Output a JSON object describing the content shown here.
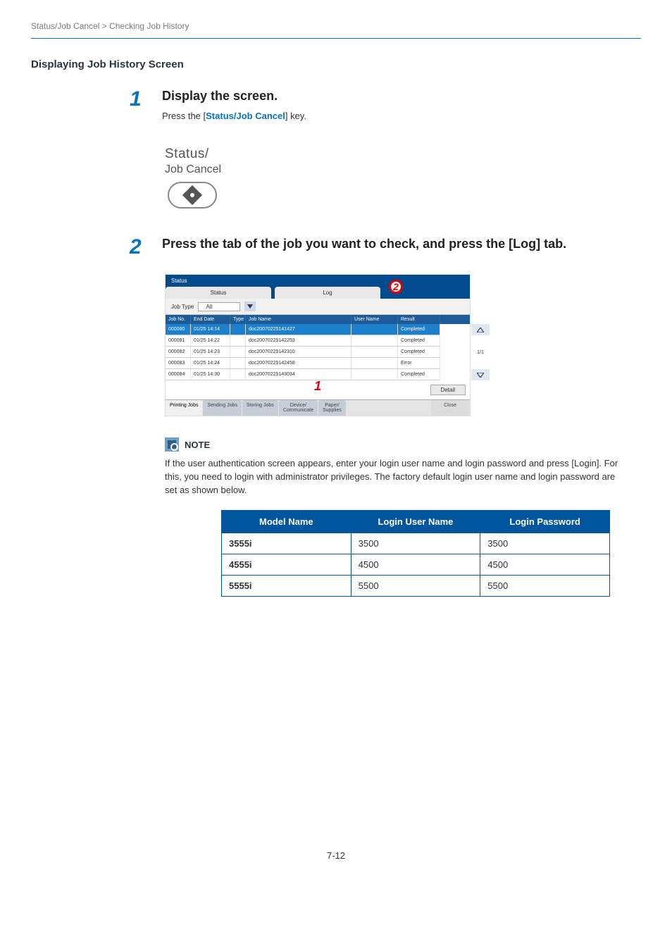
{
  "breadcrumb": "Status/Job Cancel > Checking Job History",
  "section_title": "Displaying Job History Screen",
  "step1": {
    "num": "1",
    "heading": "Display the screen.",
    "prefix": "Press the [",
    "key": "Status/Job Cancel",
    "suffix": "] key.",
    "key_line1": "Status/",
    "key_line2": "Job Cancel"
  },
  "step2": {
    "num": "2",
    "heading": "Press the tab of the job you want to check, and press the [Log] tab."
  },
  "device": {
    "title": "Status",
    "mode_status": "Status",
    "mode_log": "Log",
    "jobtype_label": "Job Type",
    "jobtype_value": "All",
    "cols": {
      "no": "Job No.",
      "end": "End Date",
      "type": "Type",
      "name": "Job Name",
      "user": "User Name",
      "result": "Result"
    },
    "rows": [
      {
        "no": "000080",
        "end": "01/25 14:14",
        "type": "",
        "name": "doc20070225141427",
        "user": "",
        "result": "Completed"
      },
      {
        "no": "000081",
        "end": "01/25 14:22",
        "type": "",
        "name": "doc20070225142253",
        "user": "",
        "result": "Completed"
      },
      {
        "no": "000082",
        "end": "01/25 14:23",
        "type": "",
        "name": "doc20070225142310",
        "user": "",
        "result": "Completed"
      },
      {
        "no": "000083",
        "end": "01/25 14:24",
        "type": "",
        "name": "doc20070225142458",
        "user": "",
        "result": "Error"
      },
      {
        "no": "000084",
        "end": "01/25 14:30",
        "type": "",
        "name": "doc20070225143034",
        "user": "",
        "result": "Completed"
      }
    ],
    "page_indicator": "1/1",
    "detail": "Detail",
    "bottom": {
      "printing": "Printing Jobs",
      "sending": "Sending Jobs",
      "storing": "Storing Jobs",
      "device": "Device/\nCommunicate",
      "paper": "Paper/\nSupplies",
      "close": "Close"
    },
    "callout1": "1",
    "callout2": "2"
  },
  "note": {
    "title": "NOTE",
    "text": "If the user authentication screen appears, enter your login user name and login password and press [Login]. For this, you need to login with administrator privileges. The factory default login user name and login password are set as shown below."
  },
  "cred": {
    "h_model": "Model Name",
    "h_user": "Login User Name",
    "h_pass": "Login Password",
    "rows": [
      {
        "model": "3555i",
        "user": "3500",
        "pass": "3500"
      },
      {
        "model": "4555i",
        "user": "4500",
        "pass": "4500"
      },
      {
        "model": "5555i",
        "user": "5500",
        "pass": "5500"
      }
    ]
  },
  "page_num": "7-12"
}
